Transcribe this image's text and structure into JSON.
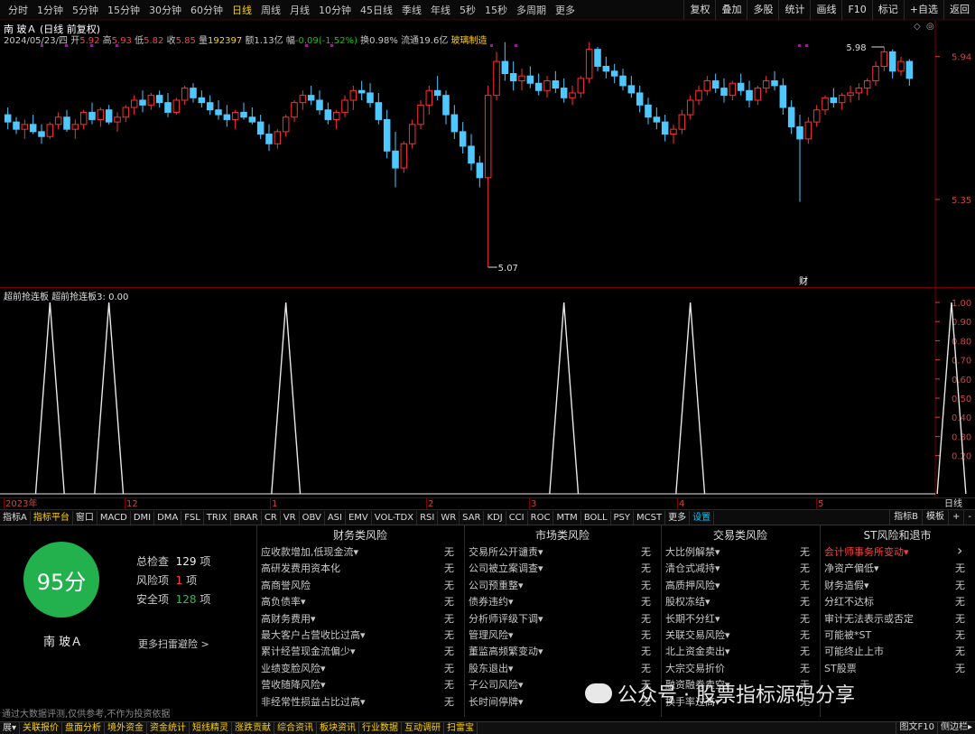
{
  "toolbar": {
    "periods": [
      "分时",
      "1分钟",
      "5分钟",
      "15分钟",
      "30分钟",
      "60分钟",
      "日线",
      "周线",
      "月线",
      "10分钟",
      "45日线",
      "季线",
      "年线",
      "5秒",
      "15秒",
      "多周期",
      "更多"
    ],
    "active": "日线",
    "right": [
      "复权",
      "叠加",
      "多股",
      "统计",
      "画线",
      "F10",
      "标记",
      "+自选",
      "返回"
    ]
  },
  "stock": {
    "title": "南 玻Ａ (日线 前复权)",
    "name": "南 玻Ａ",
    "date": "2024/05/23/四",
    "open_label": "开",
    "open": "5.92",
    "high_label": "高",
    "high": "5.93",
    "low_label": "低",
    "low": "5.82",
    "close_label": "收",
    "close": "5.85",
    "vol_label": "量",
    "vol": "192397",
    "amt_label": "额",
    "amt": "1.13亿",
    "chg_label": "幅",
    "chg": "-0.09(-1.52%)",
    "turn_label": "换",
    "turn": "0.98%",
    "float_label": "流通",
    "float": "19.6亿",
    "sector": "玻璃制造"
  },
  "price_axis": {
    "high": "5.94",
    "low": "5.35",
    "max_mark": "5.98",
    "min_mark": "5.07"
  },
  "indicator": {
    "title": "超前抢连板",
    "line": "超前抢连板3: 0.00",
    "axis": [
      "1.00",
      "0.90",
      "0.80",
      "0.70",
      "0.60",
      "0.50",
      "0.40",
      "0.30",
      "0.20"
    ],
    "spikes": [
      1,
      1,
      1,
      1,
      1,
      1
    ]
  },
  "dates": {
    "labels": [
      "2023年",
      "12",
      "1",
      "2",
      "3",
      "4",
      "5"
    ],
    "right": "日线"
  },
  "tabs": [
    "指标A",
    "指标平台",
    "窗口",
    "MACD",
    "DMI",
    "DMA",
    "FSL",
    "TRIX",
    "BRAR",
    "CR",
    "VR",
    "OBV",
    "ASI",
    "EMV",
    "VOL-TDX",
    "RSI",
    "WR",
    "SAR",
    "KDJ",
    "CCI",
    "ROC",
    "MTM",
    "BOLL",
    "PSY",
    "MCST",
    "更多",
    "设置"
  ],
  "tabs_right": [
    "指标B",
    "模板",
    "+",
    "-"
  ],
  "score": {
    "value": "95分",
    "total_label": "总检查",
    "total": "129",
    "risk_label": "风险项",
    "risk": "1",
    "safe_label": "安全项",
    "safe": "128",
    "unit": "项",
    "more": "更多扫雷避险 >"
  },
  "risk_cols": [
    {
      "title": "财务类风险",
      "items": [
        "应收款增加,低现金流▾",
        "高研发费用资本化",
        "高商誉风险",
        "高负债率▾",
        "高财务费用▾",
        "最大客户占营收比过高▾",
        "累计经营现金流偏少▾",
        "业绩变脸风险▾",
        "营收随降风险▾",
        "非经常性损益占比过高▾"
      ],
      "status": "无"
    },
    {
      "title": "市场类风险",
      "items": [
        "交易所公开谴责▾",
        "公司被立案调查▾",
        "公司预重整▾",
        "债券违约▾",
        "分析师评级下调▾",
        "管理风险▾",
        "董监高频繁变动▾",
        "股东退出▾",
        "子公司风险▾",
        "长时间停牌▾"
      ],
      "status": "无"
    },
    {
      "title": "交易类风险",
      "items": [
        "大比例解禁▾",
        "清仓式减持▾",
        "高质押风险▾",
        "股权冻结▾",
        "长期不分红▾",
        "关联交易风险▾",
        "北上资金卖出▾",
        "大宗交易折价",
        "融资融券卖空▾",
        "换手率过高▾"
      ],
      "status": "无"
    },
    {
      "title": "ST风险和退市",
      "items": [
        "会计师事务所变动▾",
        "净资产偏低▾",
        "财务造假▾",
        "分红不达标",
        "审计无法表示或否定",
        "可能被*ST",
        "可能终止上市",
        "ST股票",
        "",
        ""
      ],
      "status": "无"
    }
  ],
  "disclaimer": "通过大数据评测,仅供参考,不作为投资依据",
  "watermark": "公众号 · 股票指标源码分享",
  "bottom": [
    "展▾",
    "关联报价",
    "盘面分析",
    "境外资金",
    "资金统计",
    "短线精灵",
    "涨跌贡献",
    "综合资讯",
    "板块资讯",
    "行业数据",
    "互动调研",
    "扫雷宝"
  ],
  "bottom_right": [
    "图文F10",
    "侧边栏▸"
  ],
  "chart_data": {
    "type": "candlestick",
    "note_markers": "财",
    "y_range": [
      5.07,
      5.98
    ],
    "ohlc": [
      [
        5.7,
        5.73,
        5.64,
        5.67
      ],
      [
        5.67,
        5.69,
        5.62,
        5.64
      ],
      [
        5.64,
        5.68,
        5.6,
        5.66
      ],
      [
        5.66,
        5.7,
        5.62,
        5.63
      ],
      [
        5.63,
        5.66,
        5.58,
        5.61
      ],
      [
        5.61,
        5.67,
        5.6,
        5.66
      ],
      [
        5.66,
        5.71,
        5.64,
        5.69
      ],
      [
        5.69,
        5.72,
        5.63,
        5.64
      ],
      [
        5.64,
        5.68,
        5.6,
        5.66
      ],
      [
        5.66,
        5.72,
        5.64,
        5.71
      ],
      [
        5.71,
        5.75,
        5.66,
        5.68
      ],
      [
        5.68,
        5.73,
        5.65,
        5.72
      ],
      [
        5.72,
        5.74,
        5.66,
        5.67
      ],
      [
        5.67,
        5.71,
        5.63,
        5.69
      ],
      [
        5.69,
        5.74,
        5.67,
        5.73
      ],
      [
        5.73,
        5.78,
        5.7,
        5.76
      ],
      [
        5.76,
        5.8,
        5.71,
        5.74
      ],
      [
        5.74,
        5.79,
        5.72,
        5.78
      ],
      [
        5.78,
        5.8,
        5.73,
        5.75
      ],
      [
        5.75,
        5.79,
        5.69,
        5.71
      ],
      [
        5.71,
        5.77,
        5.7,
        5.76
      ],
      [
        5.76,
        5.82,
        5.74,
        5.81
      ],
      [
        5.81,
        5.83,
        5.75,
        5.77
      ],
      [
        5.77,
        5.8,
        5.73,
        5.75
      ],
      [
        5.75,
        5.78,
        5.7,
        5.72
      ],
      [
        5.72,
        5.76,
        5.68,
        5.7
      ],
      [
        5.7,
        5.74,
        5.65,
        5.68
      ],
      [
        5.68,
        5.72,
        5.64,
        5.71
      ],
      [
        5.71,
        5.75,
        5.68,
        5.69
      ],
      [
        5.69,
        5.73,
        5.66,
        5.67
      ],
      [
        5.67,
        5.7,
        5.6,
        5.62
      ],
      [
        5.62,
        5.66,
        5.55,
        5.58
      ],
      [
        5.58,
        5.64,
        5.56,
        5.63
      ],
      [
        5.63,
        5.7,
        5.61,
        5.69
      ],
      [
        5.69,
        5.76,
        5.67,
        5.75
      ],
      [
        5.75,
        5.8,
        5.72,
        5.78
      ],
      [
        5.78,
        5.82,
        5.74,
        5.76
      ],
      [
        5.76,
        5.8,
        5.7,
        5.72
      ],
      [
        5.72,
        5.75,
        5.66,
        5.68
      ],
      [
        5.68,
        5.72,
        5.64,
        5.71
      ],
      [
        5.71,
        5.78,
        5.69,
        5.76
      ],
      [
        5.76,
        5.82,
        5.72,
        5.8
      ],
      [
        5.8,
        5.84,
        5.76,
        5.79
      ],
      [
        5.79,
        5.83,
        5.73,
        5.75
      ],
      [
        5.75,
        5.79,
        5.66,
        5.68
      ],
      [
        5.68,
        5.72,
        5.52,
        5.55
      ],
      [
        5.55,
        5.63,
        5.4,
        5.48
      ],
      [
        5.48,
        5.59,
        5.46,
        5.58
      ],
      [
        5.58,
        5.68,
        5.56,
        5.66
      ],
      [
        5.66,
        5.76,
        5.64,
        5.74
      ],
      [
        5.74,
        5.82,
        5.7,
        5.8
      ],
      [
        5.8,
        5.86,
        5.76,
        5.78
      ],
      [
        5.78,
        5.8,
        5.66,
        5.7
      ],
      [
        5.7,
        5.74,
        5.6,
        5.63
      ],
      [
        5.63,
        5.67,
        5.54,
        5.57
      ],
      [
        5.57,
        5.62,
        5.47,
        5.5
      ],
      [
        5.5,
        5.53,
        5.4,
        5.44
      ],
      [
        5.44,
        5.82,
        5.07,
        5.78
      ],
      [
        5.78,
        5.96,
        5.76,
        5.92
      ],
      [
        5.92,
        6.0,
        5.84,
        5.87
      ],
      [
        5.87,
        5.92,
        5.8,
        5.84
      ],
      [
        5.84,
        5.89,
        5.8,
        5.86
      ],
      [
        5.86,
        5.9,
        5.81,
        5.83
      ],
      [
        5.83,
        5.87,
        5.78,
        5.8
      ],
      [
        5.8,
        5.86,
        5.77,
        5.84
      ],
      [
        5.84,
        5.88,
        5.79,
        5.81
      ],
      [
        5.81,
        5.85,
        5.75,
        5.77
      ],
      [
        5.77,
        5.82,
        5.74,
        5.79
      ],
      [
        5.79,
        5.86,
        5.77,
        5.85
      ],
      [
        5.85,
        6.0,
        5.83,
        5.97
      ],
      [
        5.97,
        5.98,
        5.88,
        5.9
      ],
      [
        5.9,
        5.94,
        5.85,
        5.88
      ],
      [
        5.88,
        5.91,
        5.83,
        5.86
      ],
      [
        5.86,
        5.89,
        5.8,
        5.82
      ],
      [
        5.82,
        5.86,
        5.77,
        5.79
      ],
      [
        5.79,
        5.82,
        5.71,
        5.74
      ],
      [
        5.74,
        5.77,
        5.66,
        5.69
      ],
      [
        5.69,
        5.73,
        5.64,
        5.67
      ],
      [
        5.67,
        5.7,
        5.59,
        5.62
      ],
      [
        5.62,
        5.66,
        5.58,
        5.64
      ],
      [
        5.64,
        5.72,
        5.62,
        5.7
      ],
      [
        5.7,
        5.78,
        5.68,
        5.76
      ],
      [
        5.76,
        5.82,
        5.74,
        5.8
      ],
      [
        5.8,
        5.86,
        5.78,
        5.84
      ],
      [
        5.84,
        5.87,
        5.79,
        5.81
      ],
      [
        5.81,
        5.85,
        5.75,
        5.78
      ],
      [
        5.78,
        5.84,
        5.76,
        5.83
      ],
      [
        5.83,
        5.87,
        5.78,
        5.8
      ],
      [
        5.8,
        5.84,
        5.73,
        5.76
      ],
      [
        5.76,
        5.82,
        5.74,
        5.81
      ],
      [
        5.81,
        5.86,
        5.79,
        5.84
      ],
      [
        5.84,
        5.88,
        5.8,
        5.82
      ],
      [
        5.82,
        5.85,
        5.7,
        5.73
      ],
      [
        5.73,
        5.76,
        5.62,
        5.65
      ],
      [
        5.65,
        5.7,
        5.34,
        5.6
      ],
      [
        5.6,
        5.69,
        5.58,
        5.67
      ],
      [
        5.67,
        5.74,
        5.65,
        5.72
      ],
      [
        5.72,
        5.78,
        5.7,
        5.77
      ],
      [
        5.77,
        5.81,
        5.73,
        5.75
      ],
      [
        5.75,
        5.79,
        5.72,
        5.78
      ],
      [
        5.78,
        5.82,
        5.75,
        5.79
      ],
      [
        5.79,
        5.83,
        5.76,
        5.81
      ],
      [
        5.81,
        5.85,
        5.78,
        5.84
      ],
      [
        5.84,
        5.92,
        5.82,
        5.9
      ],
      [
        5.9,
        5.98,
        5.88,
        5.96
      ],
      [
        5.96,
        5.97,
        5.85,
        5.88
      ],
      [
        5.88,
        5.94,
        5.86,
        5.92
      ],
      [
        5.92,
        5.93,
        5.82,
        5.85
      ]
    ],
    "indicator_spike_bars": [
      5,
      12,
      33,
      66,
      81,
      112
    ]
  }
}
